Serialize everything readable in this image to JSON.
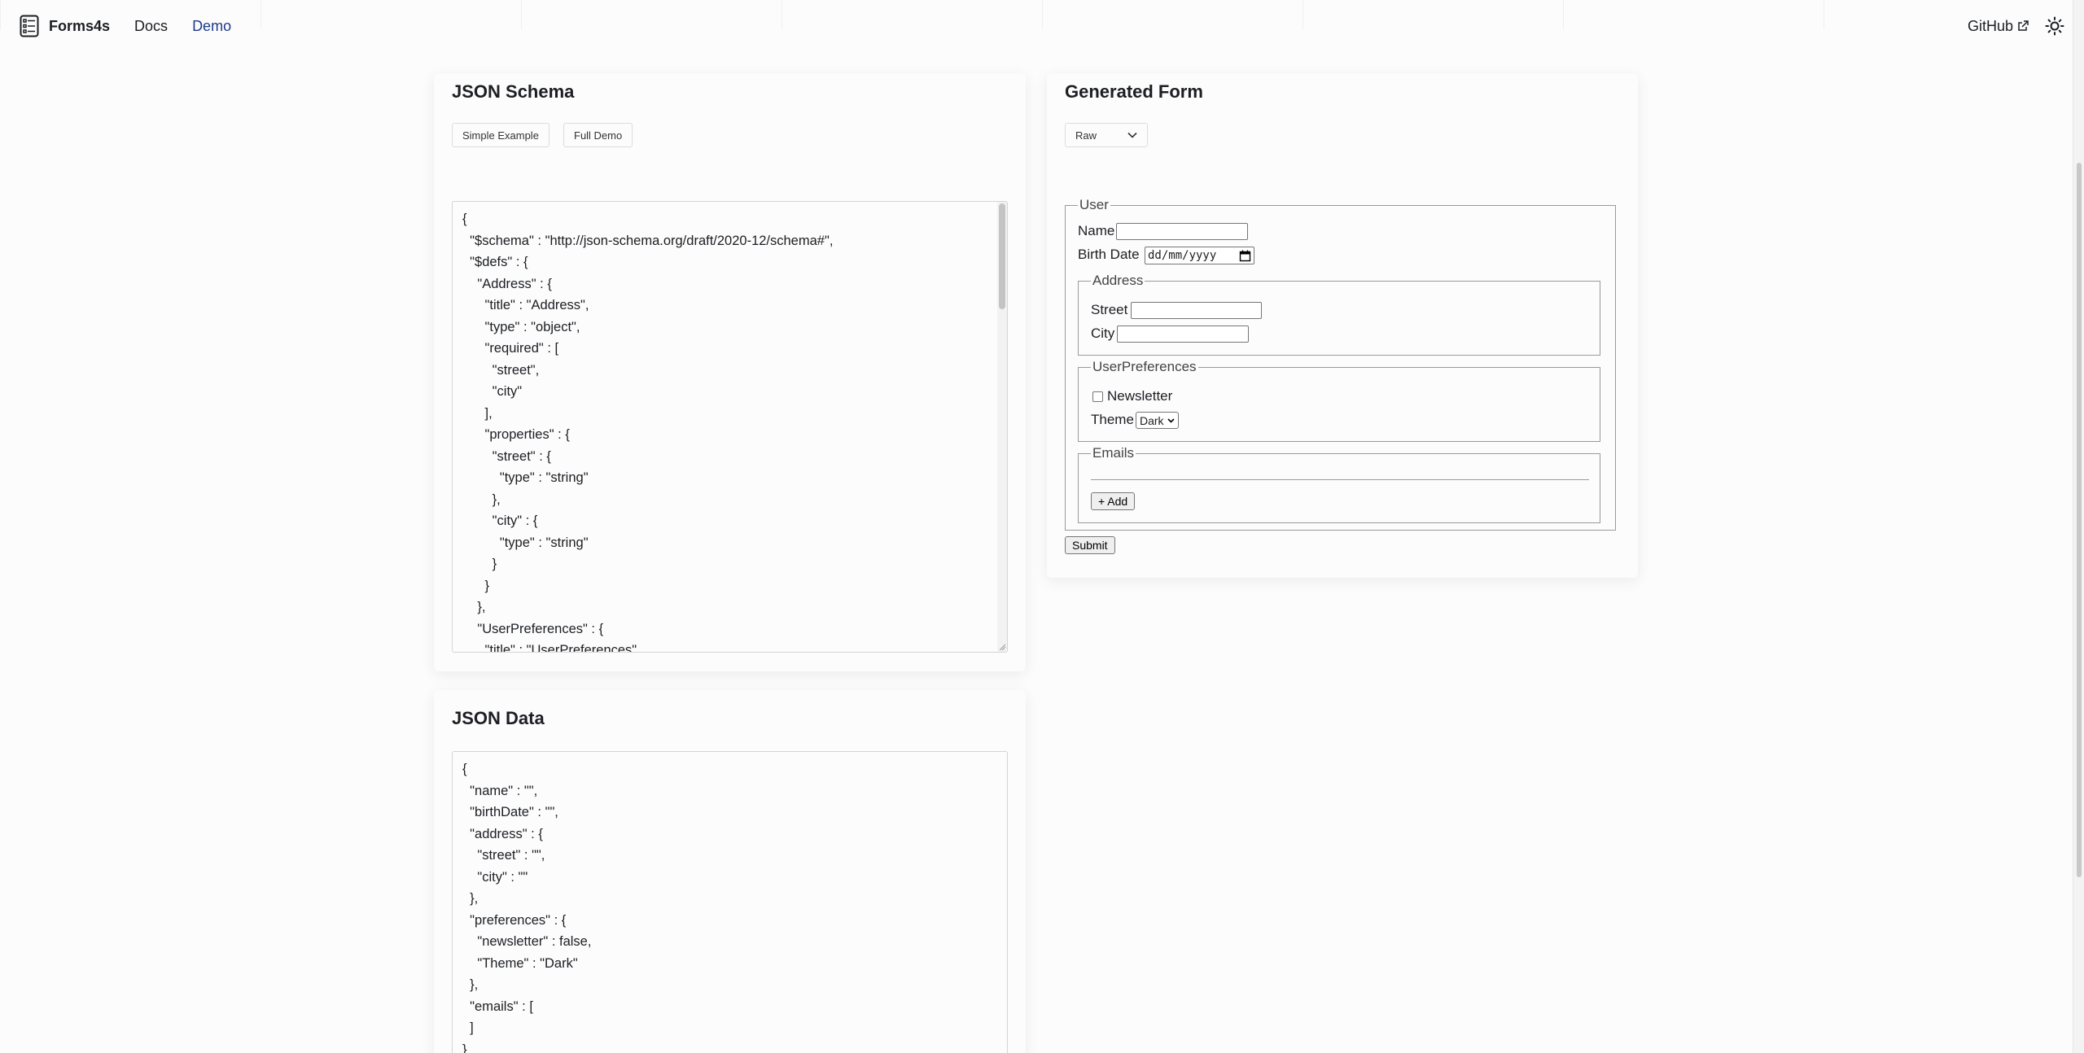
{
  "navbar": {
    "brand": "Forms4s",
    "links": [
      {
        "label": "Docs"
      },
      {
        "label": "Demo"
      }
    ],
    "github_label": "GitHub"
  },
  "schema_panel": {
    "title": "JSON Schema",
    "buttons": [
      "Simple Example",
      "Full Demo"
    ],
    "code_lines": [
      "{",
      "  \"$schema\" : \"http://json-schema.org/draft/2020-12/schema#\",",
      "  \"$defs\" : {",
      "    \"Address\" : {",
      "      \"title\" : \"Address\",",
      "      \"type\" : \"object\",",
      "      \"required\" : [",
      "        \"street\",",
      "        \"city\"",
      "      ],",
      "      \"properties\" : {",
      "        \"street\" : {",
      "          \"type\" : \"string\"",
      "        },",
      "        \"city\" : {",
      "          \"type\" : \"string\"",
      "        }",
      "      }",
      "    },",
      "    \"UserPreferences\" : {",
      "      \"title\" : \"UserPreferences\","
    ]
  },
  "form_panel": {
    "title": "Generated Form",
    "renderer_select": "Raw",
    "form": {
      "user_legend": "User",
      "name_label": "Name",
      "birth_date_label": "Birth Date",
      "date_placeholder": "dd/mm/yyyy",
      "address_legend": "Address",
      "street_label": "Street",
      "city_label": "City",
      "prefs_legend": "UserPreferences",
      "newsletter_label": "Newsletter",
      "theme_label": "Theme",
      "theme_value": "Dark",
      "emails_legend": "Emails",
      "add_label": "+ Add",
      "submit_label": "Submit"
    }
  },
  "data_panel": {
    "title": "JSON Data",
    "code_lines": [
      "{",
      "  \"name\" : \"\",",
      "  \"birthDate\" : \"\",",
      "  \"address\" : {",
      "    \"street\" : \"\",",
      "    \"city\" : \"\"",
      "  },",
      "  \"preferences\" : {",
      "    \"newsletter\" : false,",
      "    \"Theme\" : \"Dark\"",
      "  },",
      "  \"emails\" : [",
      "  ]",
      "}"
    ]
  },
  "colors": {
    "active_link": "#1e3a8a",
    "background": "#fcfcfd"
  }
}
